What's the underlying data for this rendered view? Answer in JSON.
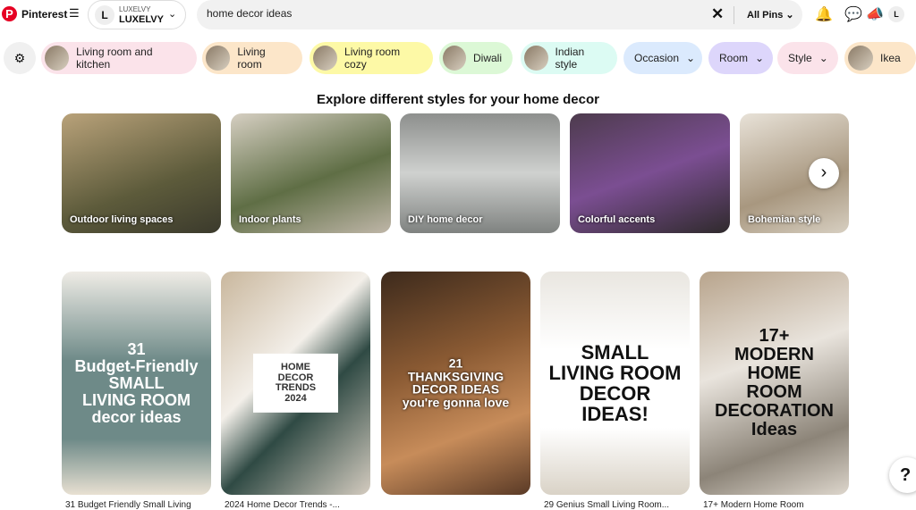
{
  "header": {
    "brand": "Pinterest",
    "account_small": "LUXELVY",
    "account_name": "LUXELVY",
    "account_initial": "L",
    "search_value": "home decor ideas",
    "filter": "All Pins"
  },
  "chips": [
    {
      "label": "Living room and kitchen",
      "color": "#fbe3ea",
      "thumb": true
    },
    {
      "label": "Living room",
      "color": "#fce6c9",
      "thumb": true
    },
    {
      "label": "Living room cozy",
      "color": "#fdf9a6",
      "thumb": true
    },
    {
      "label": "Diwali",
      "color": "#dcf8d6",
      "thumb": true
    },
    {
      "label": "Indian style",
      "color": "#dcfbf3",
      "thumb": true
    },
    {
      "label": "Occasion",
      "color": "#dbeafd",
      "thumb": false,
      "dropdown": true
    },
    {
      "label": "Room",
      "color": "#ddd6fb",
      "thumb": false,
      "dropdown": true
    },
    {
      "label": "Style",
      "color": "#fbe3ea",
      "thumb": false,
      "dropdown": true
    },
    {
      "label": "Ikea",
      "color": "#fce6c9",
      "thumb": true
    }
  ],
  "explore": {
    "heading": "Explore different styles for your home decor",
    "cards": [
      {
        "label": "Outdoor living spaces",
        "bg": "linear-gradient(160deg,#b9a27a,#5d5b3b 60%,#3b3a2c)"
      },
      {
        "label": "Indoor plants",
        "bg": "linear-gradient(160deg,#d6cfc2,#5f6e45 55%,#bfb6a8)"
      },
      {
        "label": "DIY home decor",
        "bg": "linear-gradient(180deg,#8d8f8d,#cfd1cf 50%,#7f8280)"
      },
      {
        "label": "Colorful accents",
        "bg": "linear-gradient(160deg,#4d3b4d,#7b4e92 50%,#2f2a2c)"
      },
      {
        "label": "Bohemian style",
        "bg": "linear-gradient(160deg,#e8e2d8,#a8977f 60%,#d7cfc1)"
      }
    ]
  },
  "pins": [
    {
      "caption": "31 Budget Friendly Small Living",
      "overlay": "31\nBudget-Friendly\nSMALL\nLIVING ROOM\ndecor ideas",
      "bg": "linear-gradient(180deg,#efece6,#6e8a88 40%,#6e8a88 75%,#e8e0d2)"
    },
    {
      "caption": "2024 Home Decor Trends -...",
      "overlay": "HOME\nDECOR\nTRENDS\n2024",
      "bg": "linear-gradient(135deg,#c9b79d,#f3efe9 40%,#2f4a44 60%,#d5ccc0)"
    },
    {
      "caption": "",
      "overlay": "21\nTHANKSGIVING\nDECOR IDEAS\nyou're gonna love",
      "bg": "linear-gradient(160deg,#3d2a1c,#8a5a33 40%,#c78c5a 70%,#5a3a26)"
    },
    {
      "caption": "29 Genius Small Living Room...",
      "overlay": "SMALL\nLIVING ROOM\nDECOR IDEAS!",
      "bg": "linear-gradient(180deg,#e9e6e0,#ffffff 35%,#ffffff 70%,#d9d2c6)"
    },
    {
      "caption": "17+ Modern Home Room",
      "overlay": "17+\nMODERN\nHOME\nROOM\nDECORATION\nIdeas",
      "bg": "linear-gradient(160deg,#b8a48c,#e9e4dd 40%,#8c8478 75%,#ddd6cc)"
    }
  ]
}
